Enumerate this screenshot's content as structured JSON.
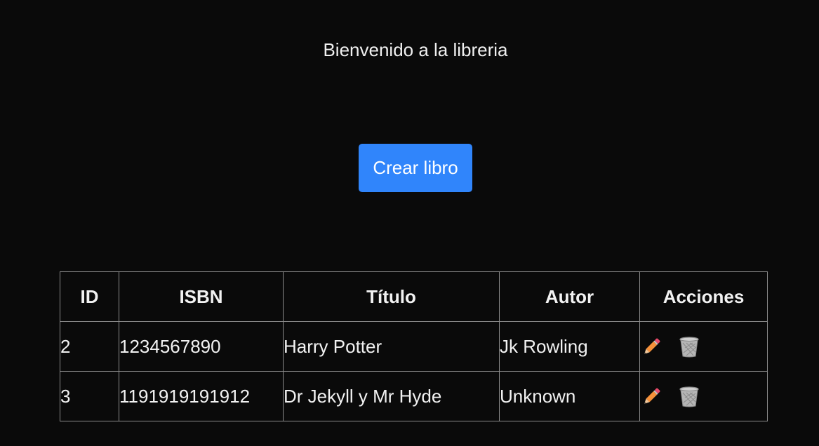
{
  "header": {
    "welcome_text": "Bienvenido a la libreria"
  },
  "actions": {
    "create_label": "Crear libro"
  },
  "table": {
    "columns": [
      "ID",
      "ISBN",
      "Título",
      "Autor",
      "Acciones"
    ],
    "rows": [
      {
        "id": "2",
        "isbn": "1234567890",
        "title": "Harry Potter",
        "author": "Jk Rowling",
        "edit_icon": "pencil-icon",
        "delete_icon": "wastebasket-icon"
      },
      {
        "id": "3",
        "isbn": "1191919191912",
        "title": "Dr Jekyll y Mr Hyde",
        "author": "Unknown",
        "edit_icon": "pencil-icon",
        "delete_icon": "wastebasket-icon"
      }
    ]
  },
  "colors": {
    "background": "#0a0a0a",
    "primary_button": "#3085fb",
    "table_border": "#8a8a8a",
    "text": "#f2f2f2"
  }
}
